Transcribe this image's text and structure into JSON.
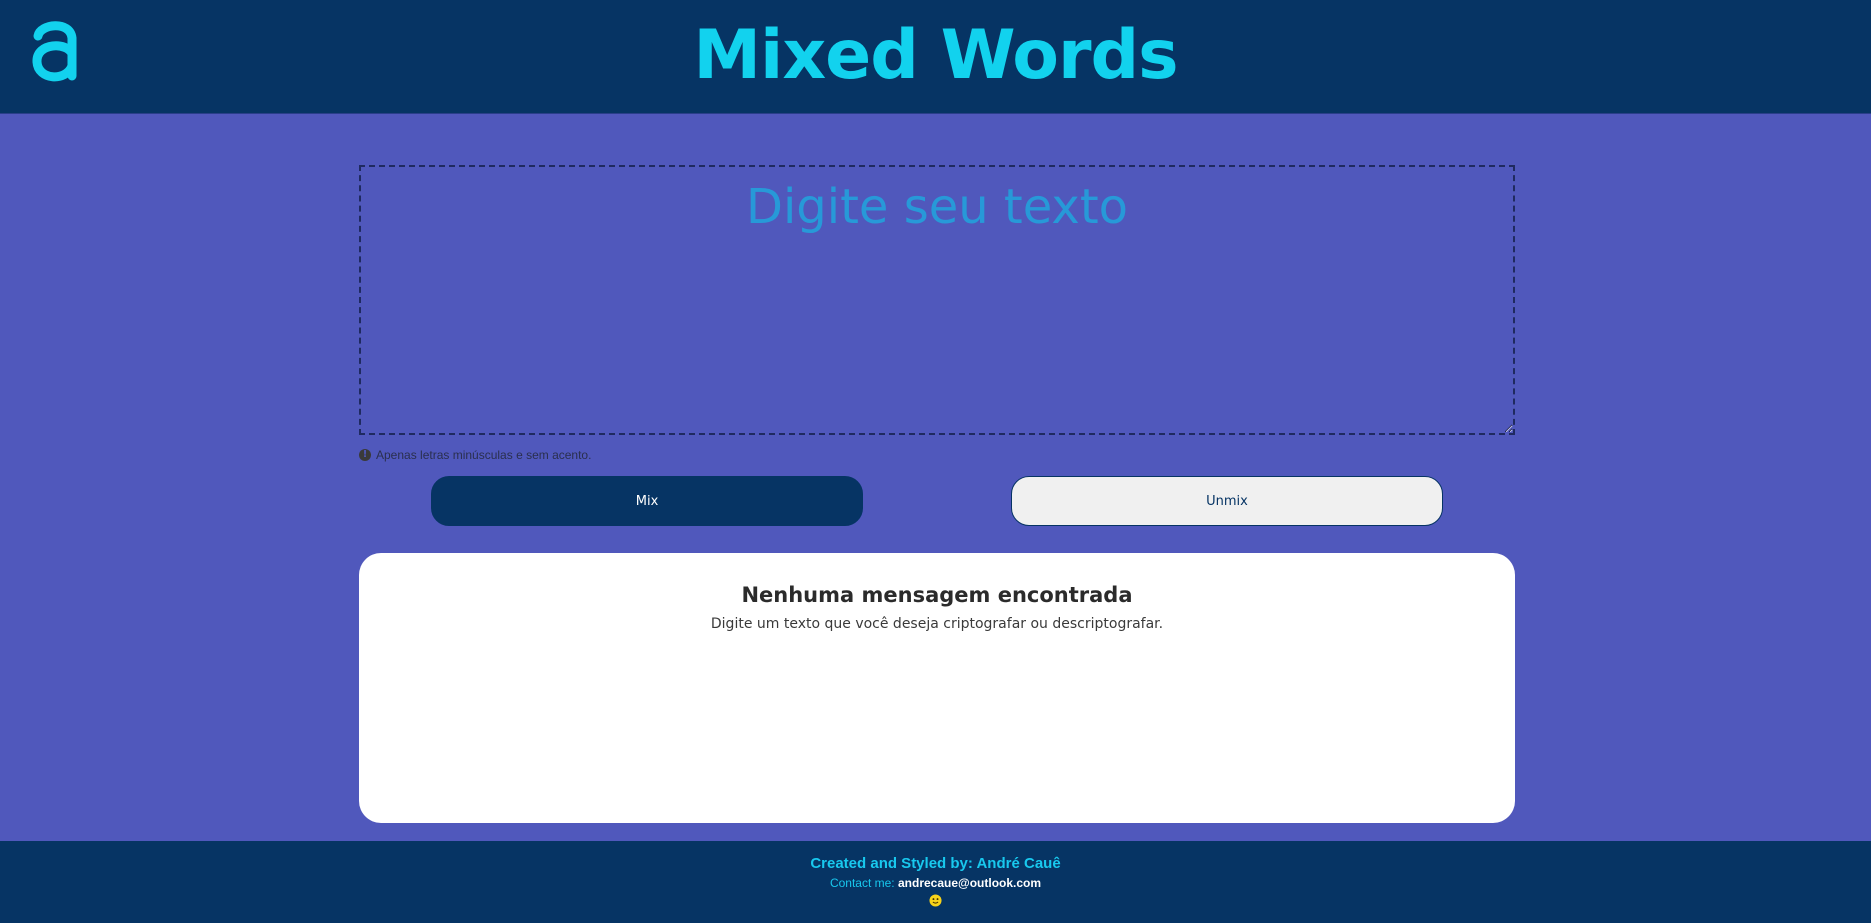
{
  "header": {
    "title": "Mixed Words",
    "logo_icon": "letter-a-logo-icon"
  },
  "input": {
    "placeholder": "Digite seu texto",
    "value": ""
  },
  "hint": {
    "icon": "info-icon",
    "icon_glyph": "!",
    "text": "Apenas letras minúsculas e sem acento."
  },
  "buttons": {
    "mix_label": "Mix",
    "unmix_label": "Unmix"
  },
  "result": {
    "title": "Nenhuma mensagem encontrada",
    "subtitle": "Digite um texto que você deseja criptografar ou descriptografar."
  },
  "footer": {
    "credit": "Created and Styled by: André Cauê",
    "contact_label": "Contact me:",
    "contact_email": "andrecaue@outlook.com",
    "emoji_icon": "smiley-face-icon"
  },
  "colors": {
    "page_background": "#5058bc",
    "header_background": "#063464",
    "accent": "#12d2ee",
    "placeholder_text": "#2799d8",
    "card_background": "#ffffff"
  }
}
